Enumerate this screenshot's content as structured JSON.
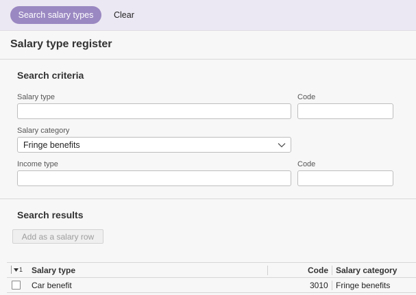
{
  "toolbar": {
    "search_label": "Search salary types",
    "clear_label": "Clear",
    "accent_color": "#9a88c2"
  },
  "page_title": "Salary type register",
  "search_criteria": {
    "title": "Search criteria",
    "salary_type": {
      "label": "Salary type",
      "value": ""
    },
    "salary_type_code": {
      "label": "Code",
      "value": ""
    },
    "salary_category": {
      "label": "Salary category",
      "value": "Fringe benefits",
      "icon": "chevron-down-icon"
    },
    "income_type": {
      "label": "Income type",
      "value": ""
    },
    "income_type_code": {
      "label": "Code",
      "value": ""
    }
  },
  "search_results": {
    "title": "Search results",
    "add_button_label": "Add as a salary row",
    "sort_indicator": "1",
    "columns": {
      "salary_type": "Salary type",
      "code": "Code",
      "salary_category": "Salary category"
    },
    "rows": [
      {
        "salary_type": "Car benefit",
        "code": "3010",
        "salary_category": "Fringe benefits",
        "checked": false
      }
    ]
  }
}
